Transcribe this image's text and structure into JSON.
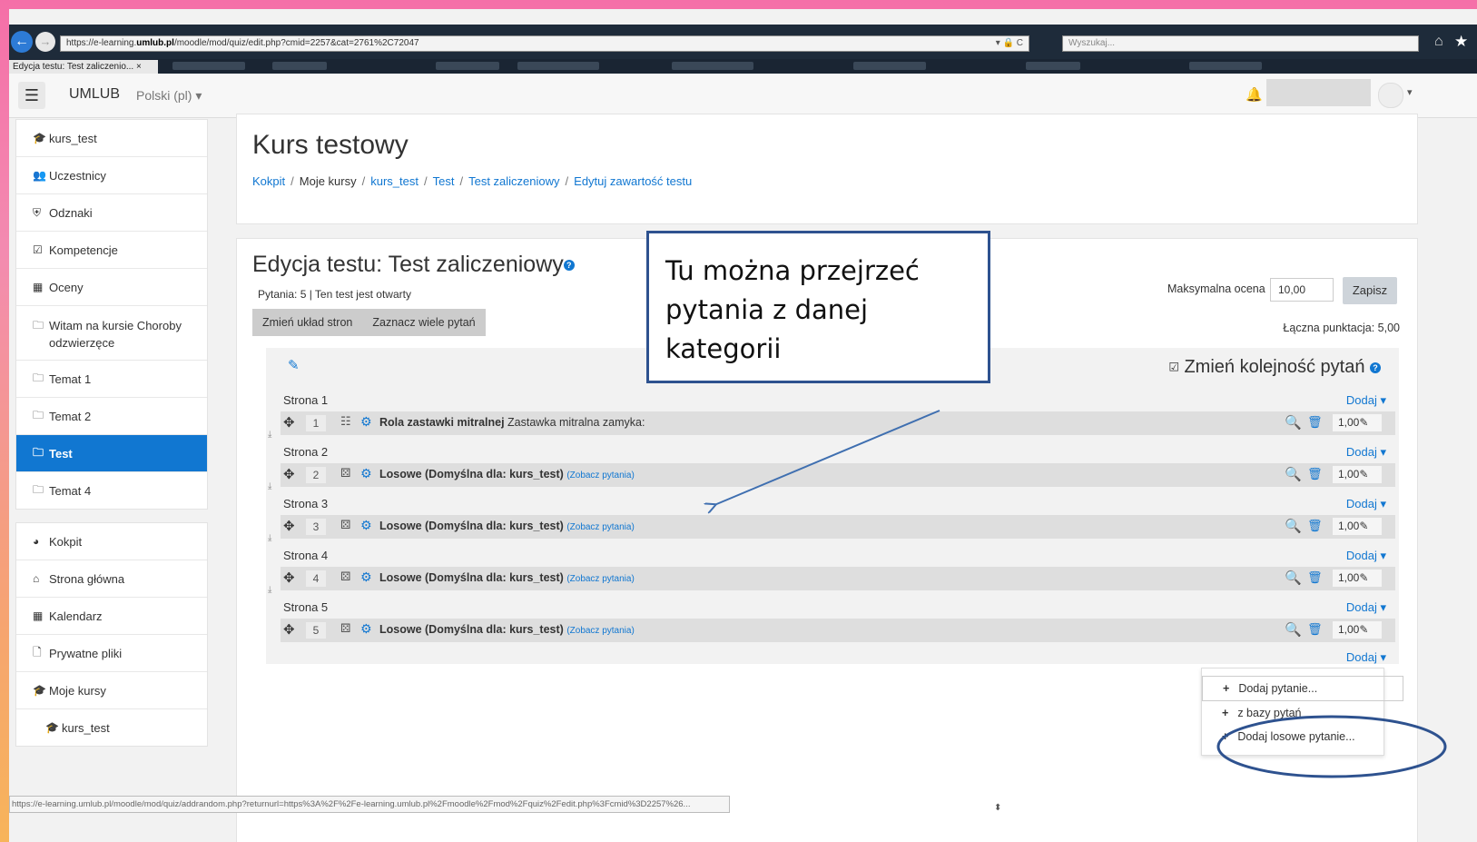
{
  "browser": {
    "url_prefix": "https://e-learning.",
    "url_domain": "umlub.pl",
    "url_path": "/moodle/mod/quiz/edit.php?cmid=2257&cat=2761%2C72047",
    "url_controls": "▾ 🔒 C",
    "search_placeholder": "Wyszukaj...",
    "tab_title": "Edycja testu: Test zaliczenio...",
    "tab_close": "×"
  },
  "navbar": {
    "menu_icon": "☰",
    "brand": "UMLUB",
    "language": "Polski (pl)",
    "caret": "▾"
  },
  "sidebar": {
    "groups": [
      [
        {
          "label": "kurs_test",
          "icon": "graduation-cap-icon",
          "glyph": "🎓"
        },
        {
          "label": "Uczestnicy",
          "icon": "users-icon",
          "glyph": "👥"
        },
        {
          "label": "Odznaki",
          "icon": "shield-icon",
          "glyph": "⛨"
        },
        {
          "label": "Kompetencje",
          "icon": "check-square-icon",
          "glyph": "☑"
        },
        {
          "label": "Oceny",
          "icon": "table-icon",
          "glyph": "▦"
        },
        {
          "label": "Witam na kursie Choroby odzwierzęce",
          "icon": "folder-icon",
          "glyph": "🗀"
        },
        {
          "label": "Temat 1",
          "icon": "folder-icon",
          "glyph": "🗀"
        },
        {
          "label": "Temat 2",
          "icon": "folder-icon",
          "glyph": "🗀"
        },
        {
          "label": "Test",
          "icon": "folder-icon",
          "glyph": "🗀",
          "active": true
        },
        {
          "label": "Temat 4",
          "icon": "folder-icon",
          "glyph": "🗀"
        }
      ],
      [
        {
          "label": "Kokpit",
          "icon": "dashboard-icon",
          "glyph": "◕"
        },
        {
          "label": "Strona główna",
          "icon": "home-icon",
          "glyph": "⌂"
        },
        {
          "label": "Kalendarz",
          "icon": "calendar-icon",
          "glyph": "▦"
        },
        {
          "label": "Prywatne pliki",
          "icon": "file-icon",
          "glyph": "🗋"
        },
        {
          "label": "Moje kursy",
          "icon": "graduation-cap-icon",
          "glyph": "🎓"
        },
        {
          "label": "kurs_test",
          "icon": "graduation-cap-icon",
          "glyph": "🎓",
          "sub": true
        }
      ]
    ]
  },
  "header": {
    "course_title": "Kurs testowy",
    "breadcrumb": [
      {
        "label": "Kokpit",
        "link": true
      },
      {
        "label": "Moje kursy",
        "link": false
      },
      {
        "label": "kurs_test",
        "link": true
      },
      {
        "label": "Test",
        "link": true
      },
      {
        "label": "Test zaliczeniowy",
        "link": true
      },
      {
        "label": "Edytuj zawartość testu",
        "link": true
      }
    ]
  },
  "quiz": {
    "title": "Edycja testu: Test zaliczeniowy",
    "help": "?",
    "info": "Pytania: 5 | Ten test jest otwarty",
    "repaginate": "Zmień układ stron",
    "select_multiple": "Zaznacz wiele pytań",
    "max_grade_label": "Maksymalna ocena",
    "max_grade_value": "10,00",
    "save": "Zapisz",
    "total_marks": "Łączna punktacja: 5,00",
    "reorder_label": "Zmień kolejność pytań",
    "add_label": "Dodaj ▾",
    "pages": [
      {
        "page": "Strona 1",
        "num": "1",
        "type_glyph": "☷",
        "title": "Rola zastawki mitralnej",
        "rest": " Zastawka mitralna zamyka:",
        "link": "",
        "mark": "1,00"
      },
      {
        "page": "Strona 2",
        "num": "2",
        "type_glyph": "⚄",
        "title": "Losowe (Domyślna dla: kurs_test)",
        "rest": " ",
        "link": "(Zobacz pytania)",
        "mark": "1,00"
      },
      {
        "page": "Strona 3",
        "num": "3",
        "type_glyph": "⚄",
        "title": "Losowe (Domyślna dla: kurs_test)",
        "rest": " ",
        "link": "(Zobacz pytania)",
        "mark": "1,00"
      },
      {
        "page": "Strona 4",
        "num": "4",
        "type_glyph": "⚄",
        "title": "Losowe (Domyślna dla: kurs_test)",
        "rest": " ",
        "link": "(Zobacz pytania)",
        "mark": "1,00"
      },
      {
        "page": "Strona 5",
        "num": "5",
        "type_glyph": "⚄",
        "title": "Losowe (Domyślna dla: kurs_test)",
        "rest": " ",
        "link": "(Zobacz pytania)",
        "mark": "1,00"
      }
    ]
  },
  "add_menu": {
    "items": [
      {
        "label": "Dodaj pytanie..."
      },
      {
        "label": "z bazy pytań"
      },
      {
        "label": "Dodaj losowe pytanie..."
      }
    ]
  },
  "statusbar": {
    "url": "https://e-learning.umlub.pl/moodle/mod/quiz/addrandom.php?returnurl=https%3A%2F%2Fe-learning.umlub.pl%2Fmoodle%2Fmod%2Fquiz%2Fedit.php%3Fcmid%3D2257%26..."
  },
  "annotation": {
    "callout_text": "Tu można przejrzeć pytania z danej kategorii"
  },
  "colors": {
    "accent": "#1177d1",
    "active_nav": "#1177d1",
    "annotation_border": "#2e528f",
    "slide_top": "#f56fa8",
    "slide_bottom": "#f7b45a"
  }
}
